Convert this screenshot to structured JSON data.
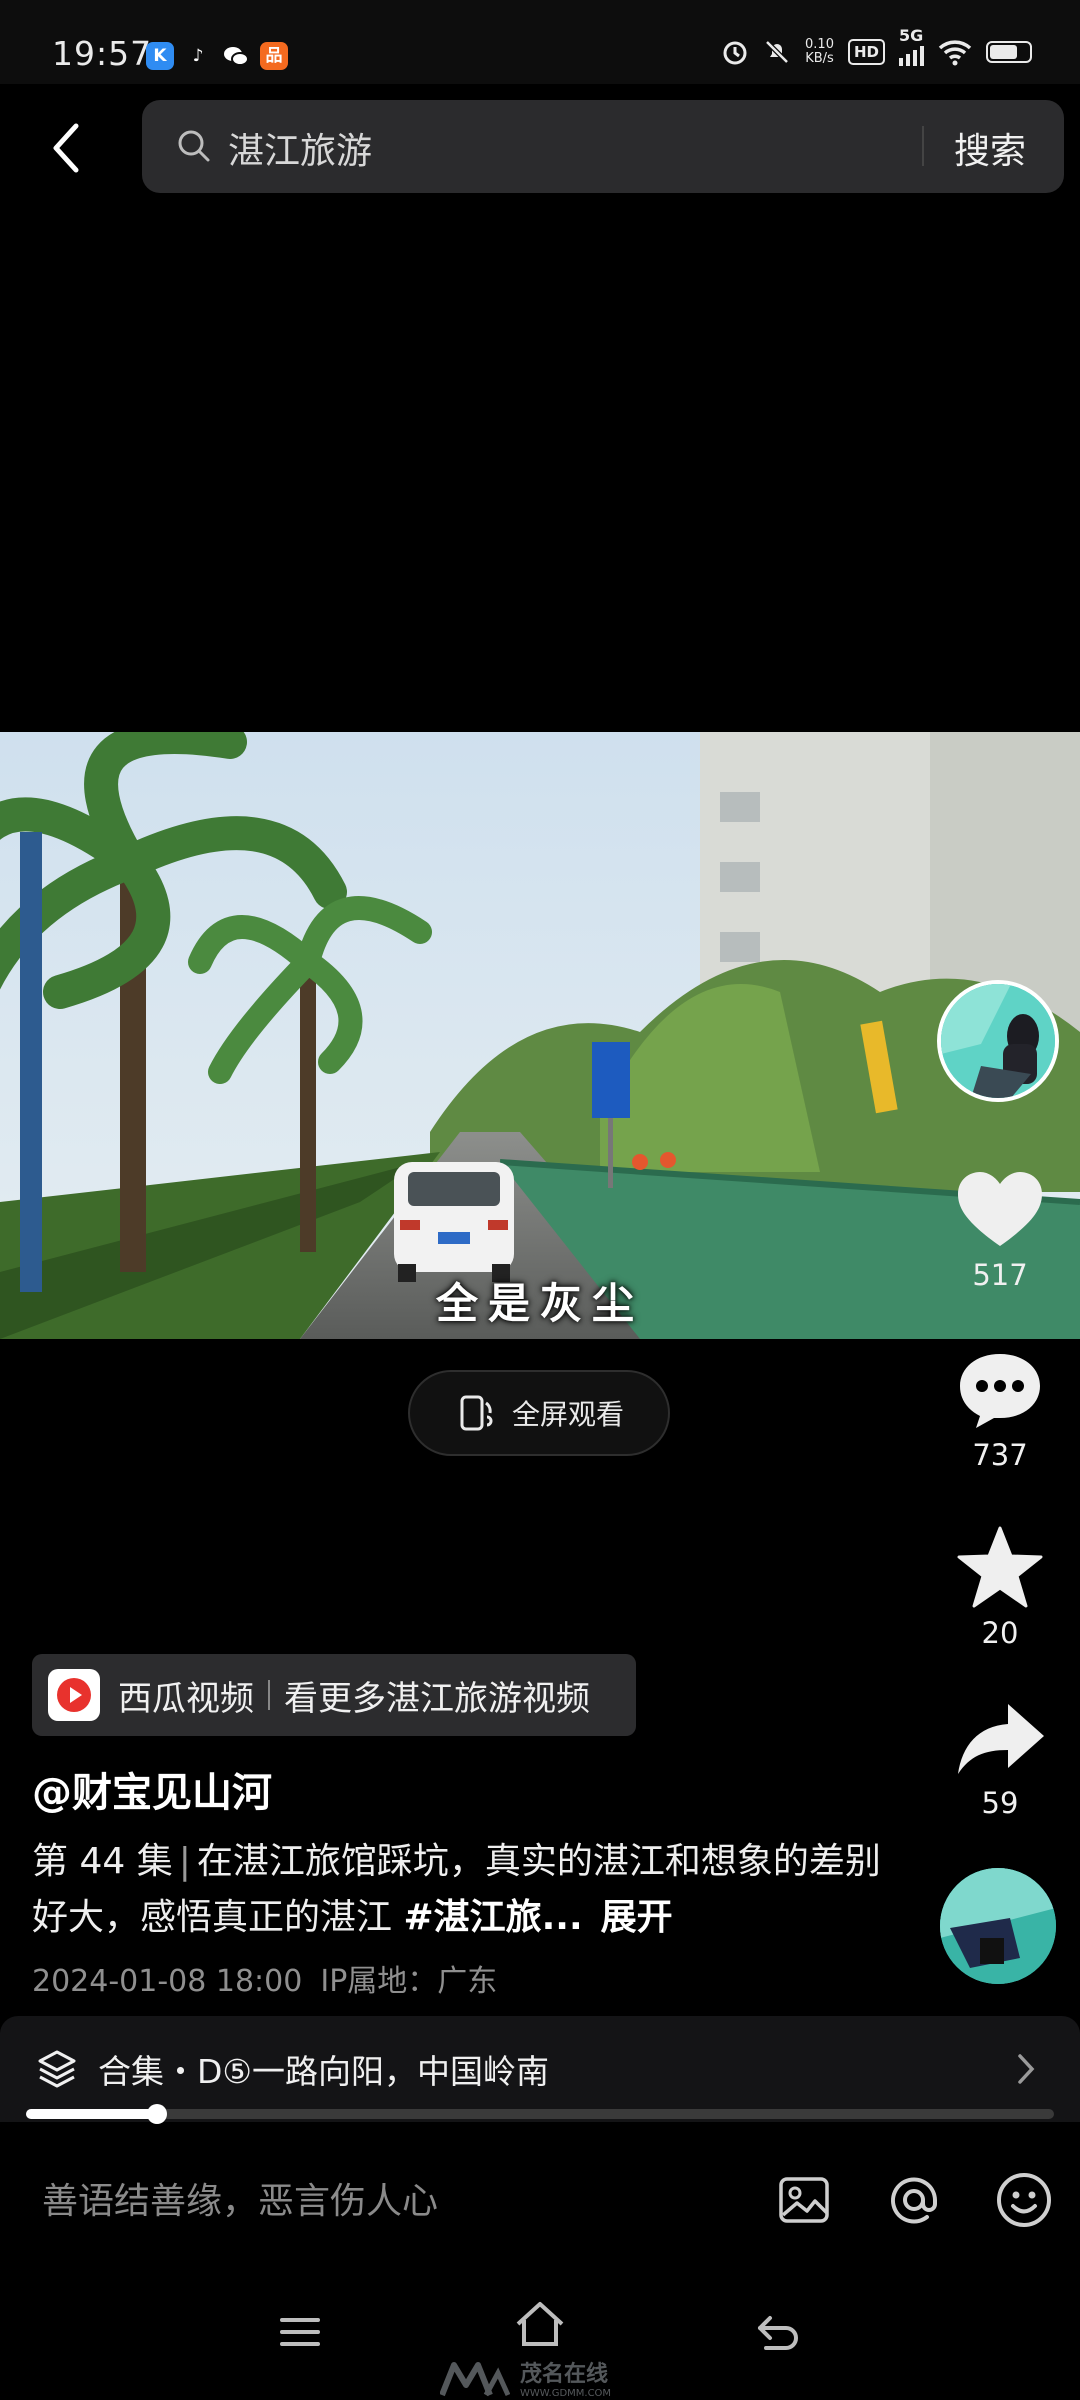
{
  "status": {
    "time": "19:57",
    "net_speed_value": "0.10",
    "net_speed_unit": "KB/s",
    "hd_label": "HD",
    "signal_label": "5G",
    "battery_level": 0.7,
    "app_icons": [
      "kuaishou-k-icon",
      "tiktok-icon",
      "wechat-icon",
      "orange-app-icon"
    ]
  },
  "search": {
    "query": "湛江旅游",
    "button_label": "搜索"
  },
  "video": {
    "subtitle": "全是灰尘",
    "fullscreen_label": "全屏观看",
    "progress": 0.127
  },
  "actions": {
    "likes": "517",
    "comments": "737",
    "favorites": "20",
    "shares": "59"
  },
  "banner": {
    "app_name": "西瓜视频",
    "cta": "看更多湛江旅游视频"
  },
  "post": {
    "author": "@财宝见山河",
    "episode": "第 44 集",
    "text": "在湛江旅馆踩坑，真实的湛江和想象的差别好大，感悟真正的湛江",
    "hashtag": "#湛江旅...",
    "expand_label": "展开",
    "date": "2024-01-08 18:00",
    "ip_location": "IP属地：广东"
  },
  "collection": {
    "label": "合集・D⑤一路向阳，中国岭南"
  },
  "comment": {
    "placeholder": "善语结善缘，恶言伤人心"
  },
  "watermark": {
    "brand": "茂名在线",
    "url": "WWW.GDMM.COM"
  },
  "colors": {
    "background": "#000000",
    "search_bg": "#2b2b2d",
    "banner_bg": "#2c2c2e",
    "xigua_red": "#e8322d",
    "muted_text": "#8f8f8f"
  }
}
